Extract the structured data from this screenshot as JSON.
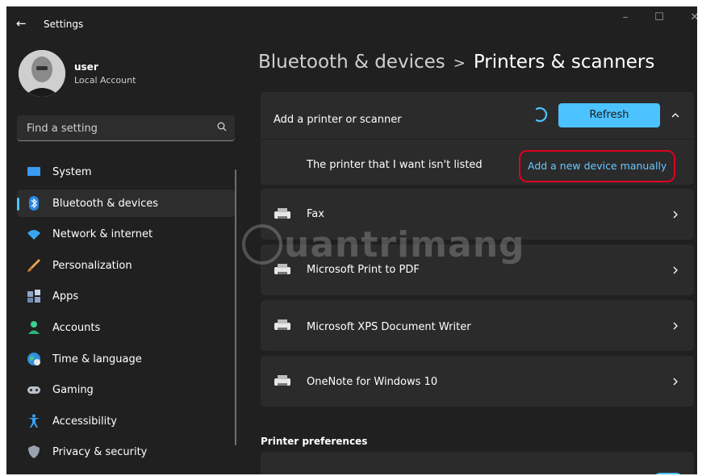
{
  "window": {
    "title": "Settings",
    "minimize_glyph": "–",
    "maximize_glyph": "☐",
    "close_glyph": "✕"
  },
  "user": {
    "name": "user",
    "account_type": "Local Account"
  },
  "search": {
    "placeholder": "Find a setting"
  },
  "nav": {
    "items": [
      {
        "label": "System",
        "icon": "monitor-icon",
        "active": false
      },
      {
        "label": "Bluetooth & devices",
        "icon": "bluetooth-icon",
        "active": true
      },
      {
        "label": "Network & internet",
        "icon": "wifi-icon",
        "active": false
      },
      {
        "label": "Personalization",
        "icon": "brush-icon",
        "active": false
      },
      {
        "label": "Apps",
        "icon": "apps-icon",
        "active": false
      },
      {
        "label": "Accounts",
        "icon": "person-icon",
        "active": false
      },
      {
        "label": "Time & language",
        "icon": "globe-icon",
        "active": false
      },
      {
        "label": "Gaming",
        "icon": "gamepad-icon",
        "active": false
      },
      {
        "label": "Accessibility",
        "icon": "accessibility-icon",
        "active": false
      },
      {
        "label": "Privacy & security",
        "icon": "shield-icon",
        "active": false
      }
    ]
  },
  "breadcrumb": {
    "parent": "Bluetooth & devices",
    "separator": ">",
    "current": "Printers & scanners"
  },
  "add_printer": {
    "label": "Add a printer or scanner",
    "refresh_label": "Refresh",
    "not_listed_label": "The printer that I want isn't listed",
    "manual_link": "Add a new device manually"
  },
  "printers": [
    {
      "name": "Fax"
    },
    {
      "name": "Microsoft Print to PDF"
    },
    {
      "name": "Microsoft XPS Document Writer"
    },
    {
      "name": "OneNote for Windows 10"
    }
  ],
  "preferences": {
    "heading": "Printer preferences"
  },
  "watermark": "uantrimang",
  "colors": {
    "accent": "#4cc2ff",
    "background": "#202020",
    "card": "#2b2b2b",
    "highlight": "#e0001b"
  }
}
